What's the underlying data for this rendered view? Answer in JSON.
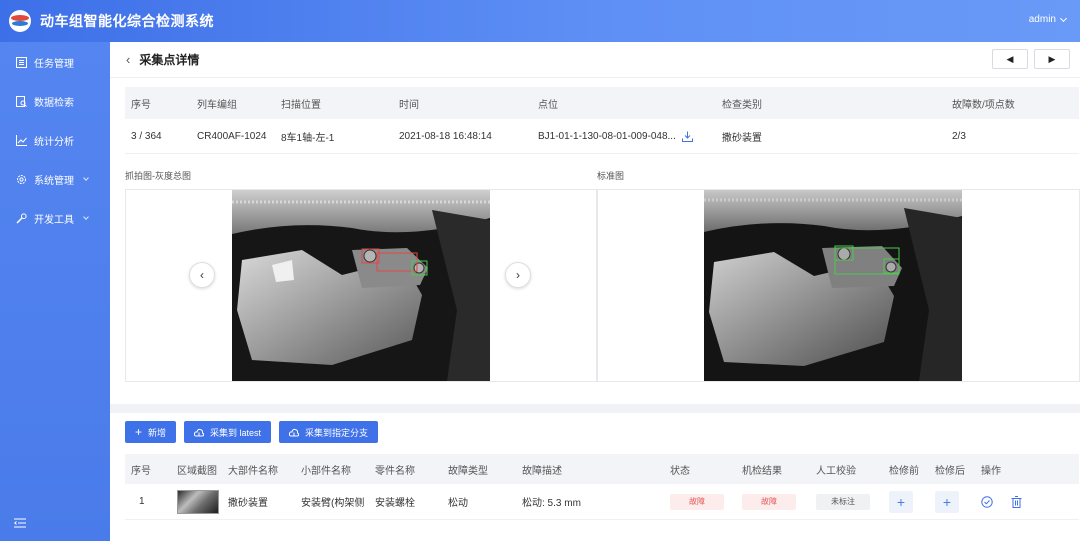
{
  "header": {
    "title": "动车组智能化综合检测系统",
    "user": "admin"
  },
  "sidebar": {
    "items": [
      {
        "label": "任务管理",
        "icon": "list-icon",
        "expandable": false
      },
      {
        "label": "数据检索",
        "icon": "search-doc-icon",
        "expandable": false
      },
      {
        "label": "统计分析",
        "icon": "chart-icon",
        "expandable": false
      },
      {
        "label": "系统管理",
        "icon": "gear-icon",
        "expandable": true
      },
      {
        "label": "开发工具",
        "icon": "wrench-icon",
        "expandable": true
      }
    ],
    "collapse_icon": "menu-collapse-icon"
  },
  "page": {
    "title": "采集点详情",
    "prev_glyph": "◀",
    "next_glyph": "▶"
  },
  "info": {
    "headers": [
      "序号",
      "列车编组",
      "扫描位置",
      "时间",
      "点位",
      "检查类别",
      "故障数/项点数"
    ],
    "row": [
      "3 / 364",
      "CR400AF-1024",
      "8车1轴-左-1",
      "2021-08-18 16:48:14",
      "BJ1-01-1-130-08-01-009-048...",
      "撒砂装置",
      "2/3"
    ]
  },
  "images": {
    "captured_label": "抓拍图-灰度总图",
    "standard_label": "标准图",
    "prev": "‹",
    "next": "›"
  },
  "toolbar": {
    "add": "新增",
    "collect_latest": "采集到 latest",
    "collect_branch": "采集到指定分支"
  },
  "parts": {
    "headers": [
      "序号",
      "区域截图",
      "大部件名称",
      "小部件名称",
      "零件名称",
      "故障类型",
      "故障描述",
      "状态",
      "机检结果",
      "人工校验",
      "检修前",
      "检修后",
      "操作"
    ],
    "rows": [
      {
        "index": "1",
        "major": "撒砂装置",
        "minor": "安装臂(构架侧",
        "component": "安装螺栓",
        "fault_type": "松动",
        "description": "松动: 5.3 mm",
        "status": "故障",
        "machine_result": "故障",
        "manual_check": "未标注"
      }
    ]
  },
  "colors": {
    "accent": "#3f72e8",
    "fault": "#e45555",
    "header_start": "#3d6fe8",
    "sidebar": "#5083ee"
  }
}
